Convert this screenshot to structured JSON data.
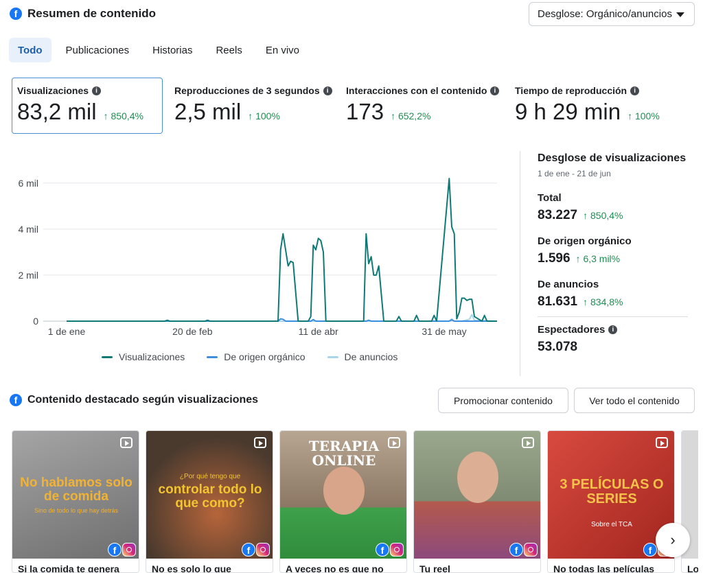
{
  "header": {
    "title": "Resumen de contenido"
  },
  "breakdown_select": {
    "value": "Desglose: Orgánico/anuncios"
  },
  "tabs": [
    {
      "label": "Todo",
      "active": true
    },
    {
      "label": "Publicaciones"
    },
    {
      "label": "Historias"
    },
    {
      "label": "Reels"
    },
    {
      "label": "En vivo"
    }
  ],
  "metrics": [
    {
      "label": "Visualizaciones",
      "value": "83,2 mil",
      "change": "850,4%"
    },
    {
      "label": "Reproducciones de 3 segundos",
      "value": "2,5 mil",
      "change": "100%"
    },
    {
      "label": "Interacciones con el contenido",
      "value": "173",
      "change": "652,2%"
    },
    {
      "label": "Tiempo de reproducción",
      "value": "9 h 29 min",
      "change": "100%"
    }
  ],
  "chart_data": {
    "type": "line",
    "y_ticks": [
      "0",
      "2 mil",
      "4 mil",
      "6 mil"
    ],
    "ylim": [
      0,
      6500
    ],
    "x_ticks": [
      {
        "label": "1 de ene",
        "day": 0
      },
      {
        "label": "20 de feb",
        "day": 50
      },
      {
        "label": "11 de abr",
        "day": 100
      },
      {
        "label": "31 de may",
        "day": 150
      }
    ],
    "x_range": [
      0,
      171
    ],
    "legend": "bottom",
    "series": [
      {
        "name": "Visualizaciones",
        "color": "#0f7a75",
        "points": [
          [
            0,
            0
          ],
          [
            39,
            0
          ],
          [
            40,
            40
          ],
          [
            41,
            0
          ],
          [
            55,
            0
          ],
          [
            56,
            40
          ],
          [
            57,
            0
          ],
          [
            84,
            0
          ],
          [
            85,
            3100
          ],
          [
            86,
            3800
          ],
          [
            87,
            3100
          ],
          [
            88,
            2400
          ],
          [
            89,
            2600
          ],
          [
            90,
            2550
          ],
          [
            92,
            0
          ],
          [
            96,
            0
          ],
          [
            97,
            200
          ],
          [
            98,
            3300
          ],
          [
            99,
            3100
          ],
          [
            100,
            3600
          ],
          [
            101,
            3500
          ],
          [
            102,
            3000
          ],
          [
            103,
            0
          ],
          [
            118,
            0
          ],
          [
            119,
            3800
          ],
          [
            120,
            2500
          ],
          [
            121,
            2800
          ],
          [
            122,
            2000
          ],
          [
            123,
            2000
          ],
          [
            124,
            2400
          ],
          [
            126,
            0
          ],
          [
            131,
            0
          ],
          [
            132,
            200
          ],
          [
            133,
            0
          ],
          [
            138,
            0
          ],
          [
            139,
            250
          ],
          [
            140,
            0
          ],
          [
            145,
            0
          ],
          [
            146,
            250
          ],
          [
            147,
            0
          ],
          [
            152,
            6200
          ],
          [
            153,
            4100
          ],
          [
            154,
            3800
          ],
          [
            155,
            100
          ],
          [
            156,
            400
          ],
          [
            157,
            1000
          ],
          [
            158,
            1000
          ],
          [
            159,
            900
          ],
          [
            160,
            950
          ],
          [
            161,
            950
          ],
          [
            162,
            200
          ],
          [
            165,
            0
          ],
          [
            166,
            250
          ],
          [
            167,
            0
          ],
          [
            171,
            0
          ]
        ]
      },
      {
        "name": "De origen orgánico",
        "color": "#3b8ee0",
        "points": [
          [
            0,
            0
          ],
          [
            84,
            0
          ],
          [
            85,
            100
          ],
          [
            86,
            80
          ],
          [
            87,
            0
          ],
          [
            97,
            0
          ],
          [
            98,
            70
          ],
          [
            99,
            0
          ],
          [
            119,
            0
          ],
          [
            120,
            40
          ],
          [
            121,
            0
          ],
          [
            152,
            0
          ],
          [
            153,
            60
          ],
          [
            154,
            0
          ],
          [
            171,
            0
          ]
        ]
      },
      {
        "name": "De anuncios",
        "color": "#a8d5ec",
        "points": [
          [
            0,
            0
          ],
          [
            152,
            0
          ],
          [
            153,
            100
          ],
          [
            154,
            0
          ],
          [
            157,
            0
          ],
          [
            160,
            80
          ],
          [
            161,
            280
          ],
          [
            162,
            40
          ],
          [
            171,
            0
          ]
        ]
      }
    ]
  },
  "side": {
    "title": "Desglose de visualizaciones",
    "date_range": "1 de ene - 21 de jun",
    "rows": [
      {
        "label": "Total",
        "value": "83.227",
        "change": "850,4%"
      },
      {
        "label": "De origen orgánico",
        "value": "1.596",
        "change": "6,3 mil%"
      },
      {
        "label": "De anuncios",
        "value": "81.631",
        "change": "834,8%"
      }
    ],
    "viewers": {
      "label": "Espectadores",
      "value": "53.078"
    }
  },
  "featured": {
    "title": "Contenido destacado según visualizaciones",
    "promote_label": "Promocionar contenido",
    "view_all_label": "Ver todo el contenido",
    "items": [
      {
        "overlay": "No hablamos solo de comida",
        "overlay_sub": "Sino de todo lo que hay detrás",
        "caption": "Si la comida te genera",
        "bg": "#8c8c8c",
        "text_color": "#f2b233"
      },
      {
        "overlay_top": "¿Por qué tengo que",
        "overlay": "controlar todo lo que como?",
        "caption": "No es solo lo que",
        "bg": "#5a4a3c",
        "text_color": "#f2c430"
      },
      {
        "overlay": "TERAPIA ONLINE",
        "caption": "A veces no es que no",
        "bg": "#a08a74",
        "text_color": "#ffffff"
      },
      {
        "caption": "Tu reel",
        "bg": "#8f9e88",
        "text_color": "#ffffff"
      },
      {
        "overlay": "3 PELÍCULAS O SERIES",
        "overlay_sub": "Sobre el TCA",
        "caption": "No todas las películas",
        "bg": "#c5332b",
        "text_color": "#f5c24a"
      },
      {
        "caption": "Lo",
        "bg": "#d8d8d8",
        "text_color": "#ffffff"
      }
    ]
  },
  "icons": {
    "facebook": "facebook-icon",
    "info": "info-icon",
    "arrow_up": "arrow-up-icon",
    "reel": "reel-icon",
    "instagram": "instagram-icon",
    "chevron_right": "chevron-right-icon"
  }
}
